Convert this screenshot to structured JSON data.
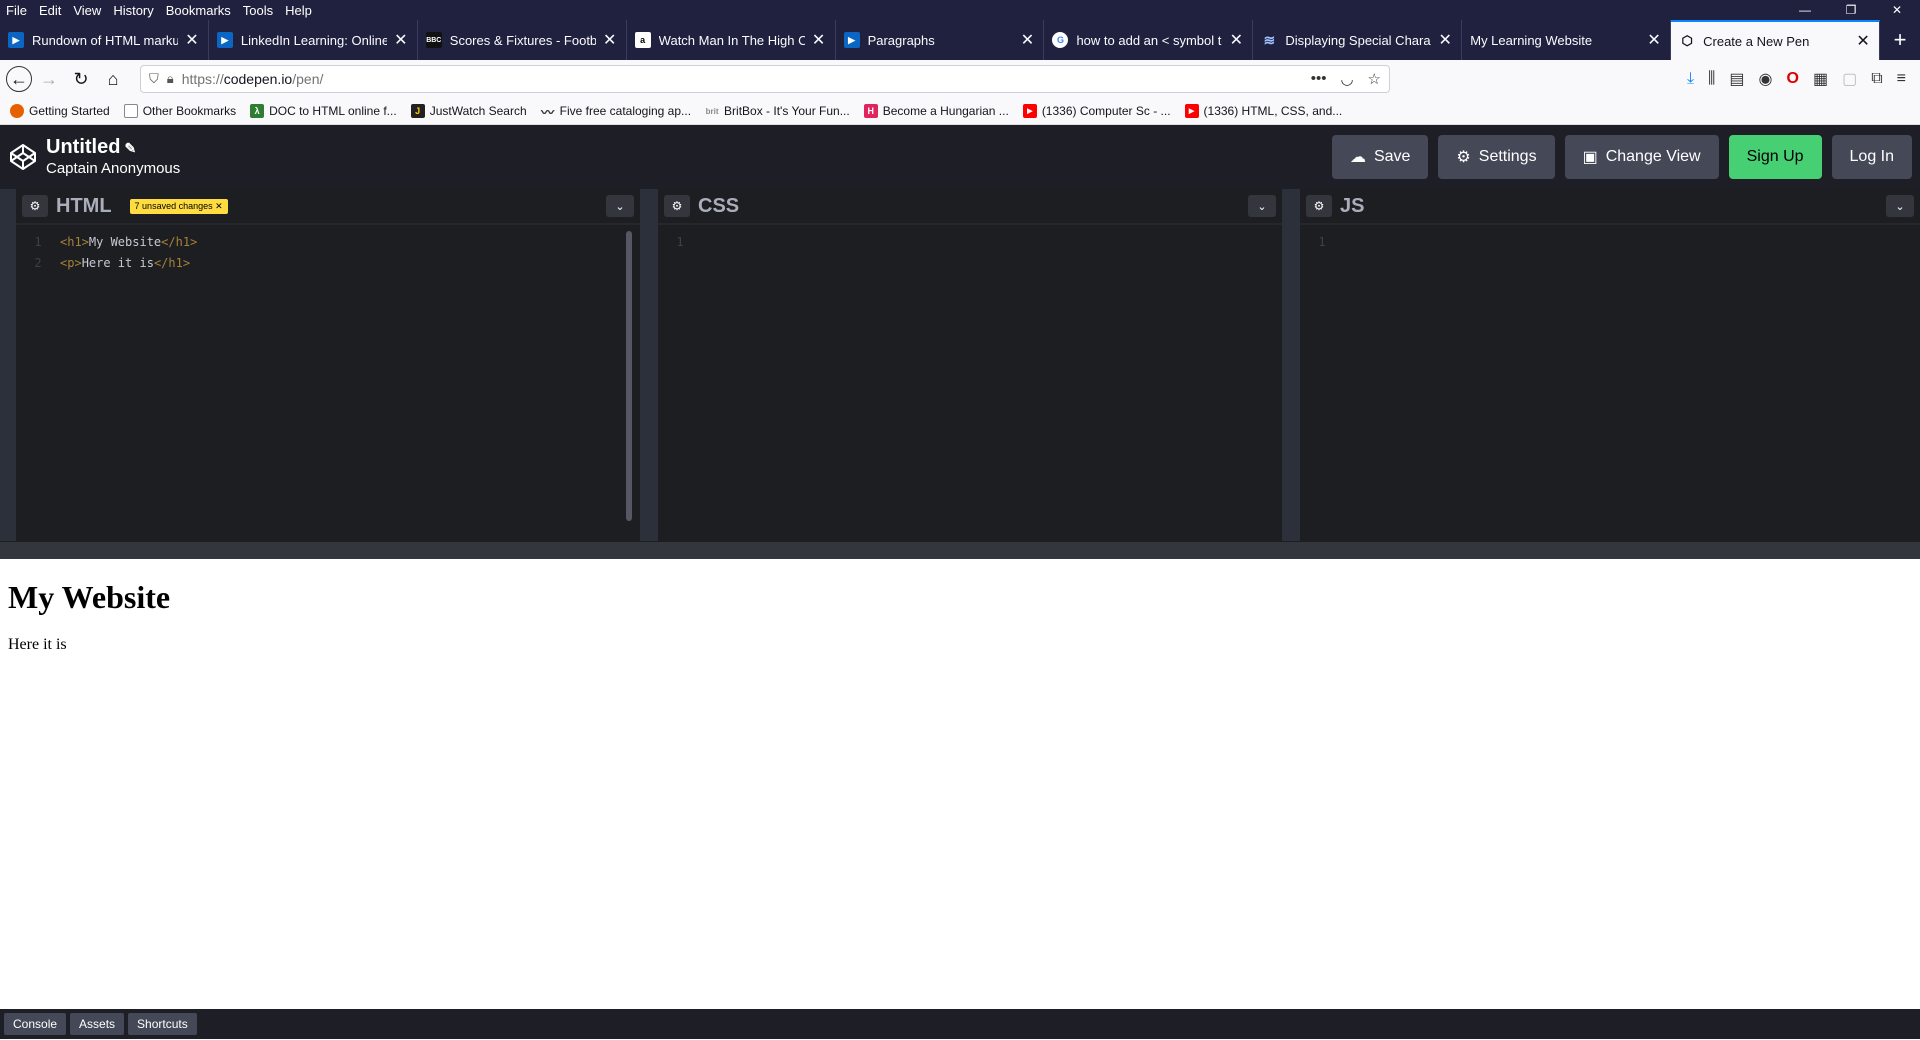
{
  "menubar": [
    "File",
    "Edit",
    "View",
    "History",
    "Bookmarks",
    "Tools",
    "Help"
  ],
  "tabs": [
    {
      "title": "Rundown of HTML markup",
      "icon": "linkedin-play-icon",
      "fav_color": "#0a66c2"
    },
    {
      "title": "LinkedIn Learning: Online Co",
      "icon": "linkedin-play-icon",
      "fav_color": "#0a66c2"
    },
    {
      "title": "Scores & Fixtures - Football",
      "icon": "bbc-icon",
      "fav_color": "#222"
    },
    {
      "title": "Watch Man In The High Castl",
      "icon": "amazon-icon",
      "fav_color": "#fff"
    },
    {
      "title": "Paragraphs",
      "icon": "linkedin-play-icon",
      "fav_color": "#0a66c2"
    },
    {
      "title": "how to add an < symbol to h",
      "icon": "google-icon",
      "fav_color": "#fff"
    },
    {
      "title": "Displaying Special Characte",
      "icon": "stackoverflow-icon",
      "fav_color": "#1f1f3a"
    },
    {
      "title": "My Learning Website",
      "icon": "",
      "fav_color": ""
    },
    {
      "title": "Create a New Pen",
      "icon": "codepen-icon",
      "fav_color": "",
      "active": true
    }
  ],
  "window_controls": [
    "—",
    "❐",
    "✕"
  ],
  "url": {
    "prefix": "https://",
    "host": "codepen.io",
    "path": "/pen/"
  },
  "bookmarks": [
    {
      "label": "Getting Started",
      "color": "#e66000",
      "glyph": ""
    },
    {
      "label": "Other Bookmarks",
      "color": "#888",
      "glyph": ""
    },
    {
      "label": "DOC to HTML online f...",
      "color": "#2e7d32",
      "glyph": "λ"
    },
    {
      "label": "JustWatch Search",
      "color": "#222",
      "glyph": "J"
    },
    {
      "label": "Five free cataloging ap...",
      "color": "#444",
      "glyph": "~"
    },
    {
      "label": "BritBox - It's Your Fun...",
      "color": "#bbb",
      "glyph": "b"
    },
    {
      "label": "Become a Hungarian ...",
      "color": "#e0245e",
      "glyph": "H"
    },
    {
      "label": "(1336) Computer Sc - ...",
      "color": "#ff0000",
      "glyph": "▶"
    },
    {
      "label": "(1336) HTML, CSS, and...",
      "color": "#ff0000",
      "glyph": "▶"
    }
  ],
  "pen": {
    "title": "Untitled",
    "author": "Captain Anonymous",
    "buttons": {
      "save": "Save",
      "settings": "Settings",
      "change_view": "Change View",
      "signup": "Sign Up",
      "login": "Log In"
    }
  },
  "editors": {
    "html": {
      "title": "HTML",
      "badge": "7 unsaved changes ✕",
      "lines": [
        {
          "num": "1",
          "open": "<h1>",
          "text": "My Website",
          "close": "</h1>"
        },
        {
          "num": "2",
          "open": "<p>",
          "text": "Here it is",
          "close": "</h1>"
        }
      ]
    },
    "css": {
      "title": "CSS",
      "line": "1"
    },
    "js": {
      "title": "JS",
      "line": "1"
    }
  },
  "preview": {
    "heading": "My Website",
    "paragraph": "Here it is"
  },
  "footer": {
    "console": "Console",
    "assets": "Assets",
    "shortcuts": "Shortcuts"
  }
}
